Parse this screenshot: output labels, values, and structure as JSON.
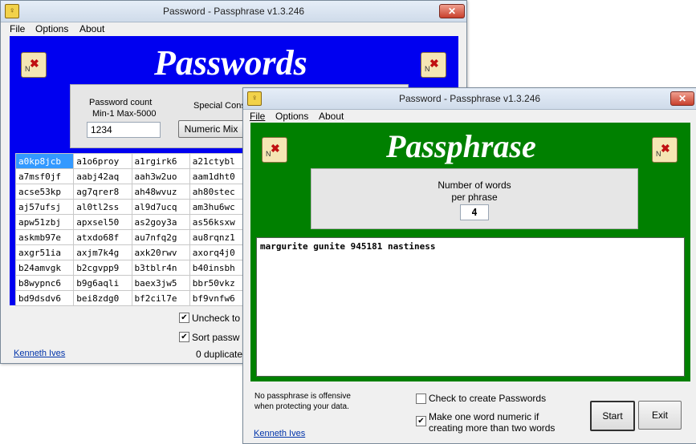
{
  "win1": {
    "title": "Password - Passphrase v1.3.246",
    "close_label": "✕",
    "menu": [
      "File",
      "Options",
      "About"
    ],
    "banner_title": "Passwords",
    "password_count_label": "Password count",
    "password_range_label": "Min-1  Max-5000",
    "password_count_value": "1234",
    "special_label": "Special Cons",
    "numeric_mix_label": "Numeric Mix",
    "grid_rows": [
      [
        "a0kp8jcb",
        "a1o6proy",
        "a1rgirk6",
        "a21ctybl"
      ],
      [
        "a7msf0jf",
        "aabj42aq",
        "aah3w2uo",
        "aam1dht0"
      ],
      [
        "acse53kp",
        "ag7qrer8",
        "ah48wvuz",
        "ah80stec"
      ],
      [
        "aj57ufsj",
        "al0tl2ss",
        "al9d7ucq",
        "am3hu6wc"
      ],
      [
        "apw51zbj",
        "apxsel50",
        "as2goy3a",
        "as56ksxw"
      ],
      [
        "askmb97e",
        "atxdo68f",
        "au7nfq2g",
        "au8rqnz1"
      ],
      [
        "axgr51ia",
        "axjm7k4g",
        "axk20rwv",
        "axorq4j0"
      ],
      [
        "b24amvgk",
        "b2cgvpp9",
        "b3tblr4n",
        "b40insbh"
      ],
      [
        "b8wypnc6",
        "b9g6aqli",
        "baex3jw5",
        "bbr50vkz"
      ],
      [
        "bd9dsdv6",
        "bei8zdg0",
        "bf2cil7e",
        "bf9vnfw6"
      ]
    ],
    "uncheck_label": "Uncheck to",
    "sort_label": "Sort passw",
    "author_link": "Kenneth Ives",
    "duplicates_label": "0 duplicate"
  },
  "win2": {
    "title": "Password - Passphrase v1.3.246",
    "close_label": "✕",
    "menu": [
      "File",
      "Options",
      "About"
    ],
    "banner_title": "Passphrase",
    "words_label_1": "Number of words",
    "words_label_2": "per phrase",
    "words_value": "4",
    "phrase_text": "margurite gunite 945181 nastiness",
    "note_1": "No passphrase is offensive",
    "note_2": "when protecting your data.",
    "check_passwords_label": "Check to create Passwords",
    "numeric_label_1": "Make one word numeric if",
    "numeric_label_2": "creating more than two words",
    "start_label": "Start",
    "exit_label": "Exit",
    "author_link": "Kenneth Ives"
  },
  "colors": {
    "banner_blue": "#0000f0",
    "banner_green": "#008000",
    "selection": "#3399ff"
  },
  "icons": [
    "app-key-icon",
    "treasure-map-icon",
    "close-icon",
    "checkmark-icon"
  ]
}
